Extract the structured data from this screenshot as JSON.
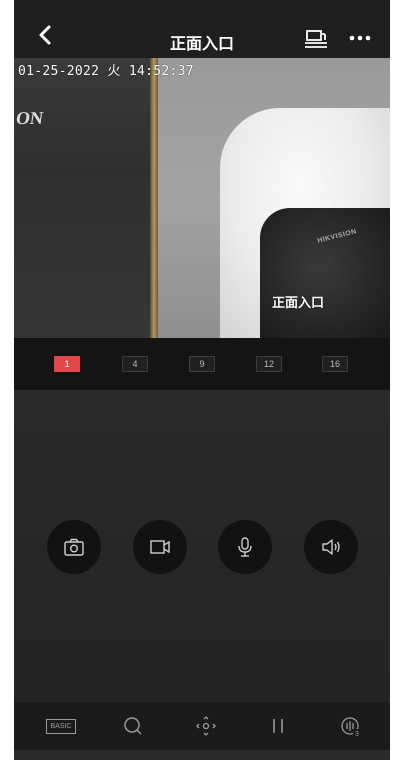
{
  "header": {
    "title": "正面入口"
  },
  "video": {
    "osd_time": "01-25-2022 火 14:52:37",
    "osd_name": "正面入口",
    "wall_text": "ON",
    "dome_brand": "HIKVISION"
  },
  "split": {
    "options": [
      "1",
      "4",
      "9",
      "12",
      "16"
    ],
    "selected": "1"
  },
  "controls": {
    "icons": [
      "camera-snapshot-icon",
      "video-record-icon",
      "microphone-icon",
      "speaker-icon"
    ]
  },
  "toolbar": {
    "basic_label": "BASIC",
    "icons": [
      "basic-quality-button",
      "search-icon",
      "ptz-icon",
      "pause-icon",
      "audio-channel-icon"
    ]
  },
  "colors": {
    "accent": "#e24848",
    "background": "#1a1a1a",
    "header": "#1f1f1f"
  }
}
